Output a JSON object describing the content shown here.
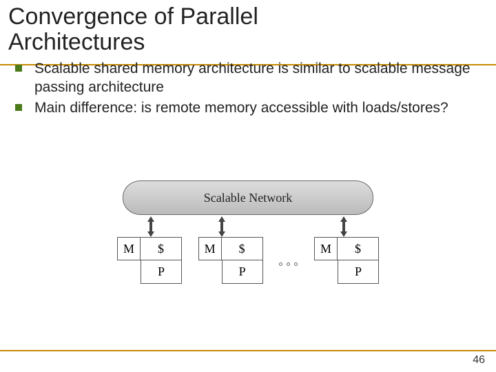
{
  "title_line1": "Convergence of Parallel",
  "title_line2": "Architectures",
  "bullets": [
    "Scalable shared memory architecture is similar to scalable message passing architecture",
    "Main difference: is remote memory accessible with loads/stores?"
  ],
  "diagram": {
    "network_label": "Scalable Network",
    "m_label": "M",
    "dollar_label": "$",
    "p_label": "P"
  },
  "slide_number": "46"
}
